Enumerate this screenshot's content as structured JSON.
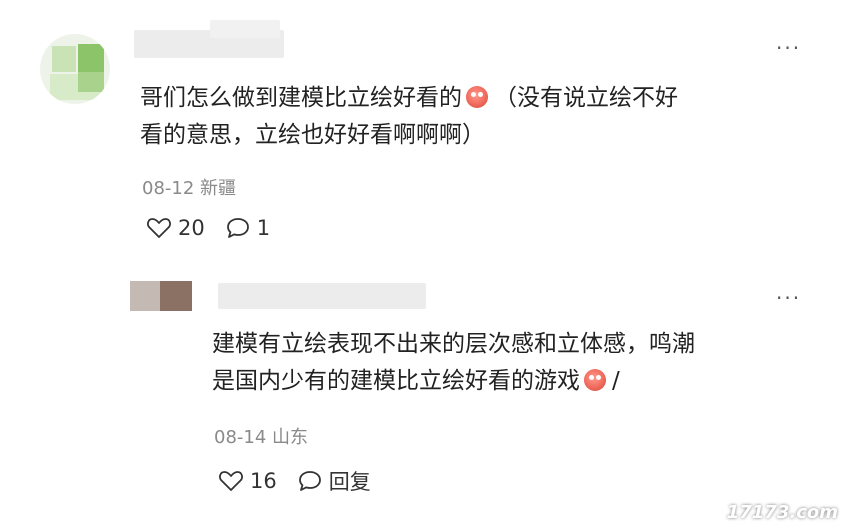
{
  "comment1": {
    "text_line1": "哥们怎么做到建模比立绘好看的",
    "text_line1_tail": "（没有说立绘不好",
    "text_line2": "看的意思，立绘也好好看啊啊啊）",
    "date": "08-12",
    "location": "新疆",
    "likes": "20",
    "replies": "1",
    "more_label": "···"
  },
  "reply1": {
    "text_line1": "建模有立绘表现不出来的层次感和立体感，鸣潮",
    "text_line2": "是国内少有的建模比立绘好看的游戏",
    "text_line2_tail": "/",
    "date": "08-14",
    "location": "山东",
    "likes": "16",
    "reply_label": "回复",
    "more_label": "···"
  },
  "watermark": "17173.com",
  "icons": {
    "like": "heart-outline-icon",
    "comment": "comment-bubble-icon",
    "more": "more-dots-icon",
    "emoji": "emoji-face-icon"
  }
}
